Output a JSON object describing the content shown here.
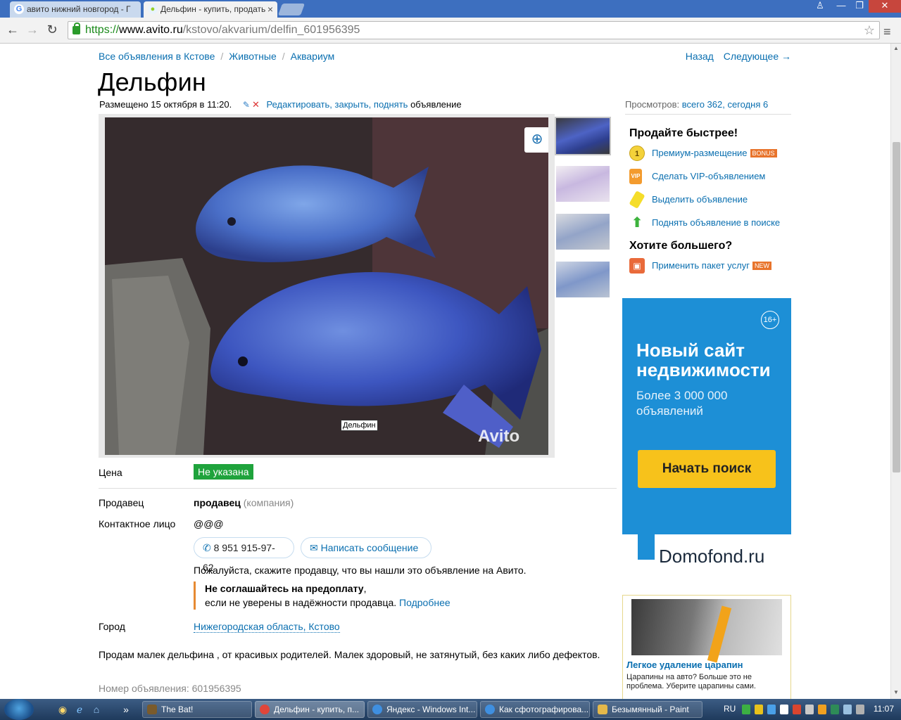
{
  "browser": {
    "tabs": [
      {
        "title": "авито нижний новгород - Г",
        "active": false
      },
      {
        "title": "Дельфин - купить, продать",
        "active": true
      }
    ],
    "url": {
      "scheme": "https://",
      "host": "www.avito.ru",
      "path": "/kstovo/akvarium/delfin_601956395"
    },
    "window_controls": {
      "user": "♙",
      "minimize": "—",
      "maximize": "❐",
      "close": "✕"
    }
  },
  "page": {
    "breadcrumbs": [
      "Все объявления в Кстове",
      "Животные",
      "Аквариум"
    ],
    "crumb_sep": "/",
    "nav": {
      "back": "Назад",
      "next": "Следующее →"
    },
    "title": "Дельфин",
    "posted_text": "Размещено 15 октября в 11:20.",
    "edit_links": "Редактировать, закрыть, поднять",
    "edit_suffix": "объявление",
    "views_label": "Просмотров:",
    "views_value": "всего 362, сегодня 6",
    "photo_watermark": "Avito",
    "photo_tooltip": "Дельфин",
    "price_label": "Цена",
    "price_value": "Не указана",
    "seller_label": "Продавец",
    "seller_name": "продавец",
    "seller_type": "(компания)",
    "contact_label": "Контактное лицо",
    "contact_name": "@@@",
    "phone": "8 951 915-97-62",
    "message_button": "Написать сообщение",
    "please_text": "Пожалуйста, скажите продавцу, что вы нашли это объявление на Авито.",
    "warning_bold": "Не соглашайтесь на предоплату",
    "warning_comma": ",",
    "warning_text": "если не уверены в надёжности продавца.",
    "warning_link": "Подробнее",
    "city_label": "Город",
    "city_value": "Нижегородская область, Кстово",
    "description": "Продам малек дельфина , от красивых родителей. Малек здоровый, не затянутый, без каких либо дефектов.",
    "ad_number": "Номер объявления: 601956395"
  },
  "sidebar": {
    "sell_title": "Продайте быстрее!",
    "services": [
      {
        "label": "Премиум-размещение",
        "badge": "BONUS",
        "icon": "premium-coin-icon"
      },
      {
        "label": "Сделать VIP-объявлением",
        "badge": "",
        "icon": "vip-icon"
      },
      {
        "label": "Выделить объявление",
        "badge": "",
        "icon": "highlight-marker-icon"
      },
      {
        "label": "Поднять объявление в поиске",
        "badge": "",
        "icon": "raise-arrow-icon"
      }
    ],
    "more_title": "Хотите большего?",
    "package": {
      "label": "Применить пакет услуг",
      "badge": "NEW"
    },
    "banner": {
      "age": "16+",
      "headline": "Новый сайт недвижимости",
      "sub": "Более 3 000 000 объявлений",
      "cta": "Начать поиск",
      "brand": "Domofond.ru",
      "bg_color": "#1d8fd6",
      "cta_color": "#f7c21b"
    },
    "promo": {
      "title": "Легкое удаление царапин",
      "text": "Царапины на авто? Больше это не проблема. Уберите царапины сами."
    }
  },
  "taskbar": {
    "tasks": [
      {
        "label": "The Bat!"
      },
      {
        "label": "Дельфин - купить, п..."
      },
      {
        "label": "Яндекс - Windows Int..."
      },
      {
        "label": "Как сфотографирова..."
      },
      {
        "label": "Безымянный - Paint"
      }
    ],
    "lang": "RU",
    "clock": "11:07"
  },
  "colors": {
    "link": "#0a6fb0",
    "price_badge": "#1fa33c",
    "warning_border": "#e68a33"
  }
}
